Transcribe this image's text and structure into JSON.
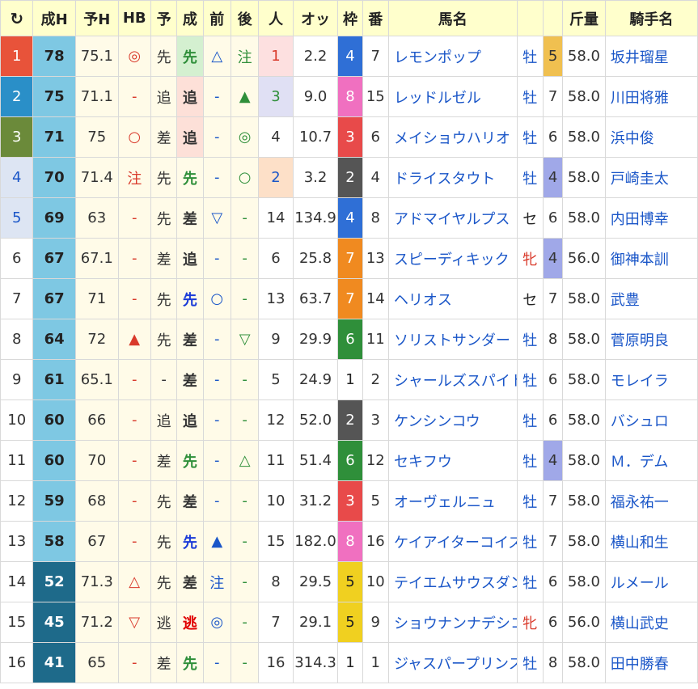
{
  "headers": [
    "↻",
    "成H",
    "予H",
    "HB",
    "予",
    "成",
    "前",
    "後",
    "人",
    "オッ",
    "枠",
    "番",
    "馬名",
    "",
    "",
    "斤量",
    "騎手名"
  ],
  "colors": {
    "header_bg": "#ffffcc",
    "link": "#1a56c8",
    "rank1": "#e8533a",
    "rank2": "#2a8fc8",
    "rank3": "#6b8a3a",
    "rank_light": "#dde5f3",
    "seih_light": "#7ec8e3",
    "seih_dark": "#1e6a8a",
    "frame": {
      "1": "#ffffff",
      "2": "#555555",
      "3": "#e84a4a",
      "4": "#2f6fd6",
      "5": "#f0d020",
      "6": "#2f8f3a",
      "7": "#f08a20",
      "8": "#f070c0"
    }
  },
  "rows": [
    {
      "rank": "1",
      "rank_color": "#e8533a",
      "rank_text": "#ffffff",
      "seih": "78",
      "seih_bg": "#7ec8e3",
      "seih_text": "#222",
      "yoh": "75.1",
      "hb": "◎",
      "hb_color": "#d93a2b",
      "yo": "先",
      "sei": "先",
      "sei_bg": "#d4f0d0",
      "sei_color": "#2f8f3a",
      "mae": "△",
      "mae_color": "#1a56c8",
      "ato": "注",
      "ato_color": "#2f8f3a",
      "ninki": "1",
      "ninki_bg": "#fde0e0",
      "ninki_color": "#d93a2b",
      "odds": "2.2",
      "waku": "4",
      "ban": "7",
      "name": "レモンポップ",
      "sex": "牡",
      "sex_class": "sexm",
      "w_mark": "5",
      "w_bg": "#f0c050",
      "kinryo": "58.0",
      "rider": "坂井瑠星"
    },
    {
      "rank": "2",
      "rank_color": "#2a8fc8",
      "rank_text": "#ffffff",
      "seih": "75",
      "seih_bg": "#7ec8e3",
      "seih_text": "#222",
      "yoh": "71.1",
      "hb": "-",
      "hb_color": "#d93a2b",
      "yo": "追",
      "sei": "追",
      "sei_bg": "#fde0d8",
      "sei_color": "#333",
      "mae": "-",
      "mae_color": "#1a56c8",
      "ato": "▲",
      "ato_color": "#2f8f3a",
      "ninki": "3",
      "ninki_bg": "#e0e0f4",
      "ninki_color": "#2f8f3a",
      "odds": "9.0",
      "waku": "8",
      "ban": "15",
      "name": "レッドルゼル",
      "sex": "牡",
      "sex_class": "sexm",
      "w_mark": "7",
      "w_bg": "#ffffff",
      "kinryo": "58.0",
      "rider": "川田将雅"
    },
    {
      "rank": "3",
      "rank_color": "#6b8a3a",
      "rank_text": "#ffffff",
      "seih": "71",
      "seih_bg": "#7ec8e3",
      "seih_text": "#222",
      "yoh": "75",
      "hb": "○",
      "hb_color": "#d93a2b",
      "yo": "差",
      "sei": "追",
      "sei_bg": "#fde0d8",
      "sei_color": "#333",
      "mae": "-",
      "mae_color": "#1a56c8",
      "ato": "◎",
      "ato_color": "#2f8f3a",
      "ninki": "4",
      "ninki_bg": "#ffffff",
      "ninki_color": "#333",
      "odds": "10.7",
      "waku": "3",
      "ban": "6",
      "name": "メイショウハリオ",
      "sex": "牡",
      "sex_class": "sexm",
      "w_mark": "6",
      "w_bg": "#ffffff",
      "kinryo": "58.0",
      "rider": "浜中俊"
    },
    {
      "rank": "4",
      "rank_color": "#dde5f3",
      "rank_text": "#1a56c8",
      "seih": "70",
      "seih_bg": "#7ec8e3",
      "seih_text": "#222",
      "yoh": "71.4",
      "hb": "注",
      "hb_color": "#d93a2b",
      "yo": "先",
      "sei": "先",
      "sei_bg": "#fffbe8",
      "sei_color": "#2f8f3a",
      "mae": "-",
      "mae_color": "#1a56c8",
      "ato": "○",
      "ato_color": "#2f8f3a",
      "ninki": "2",
      "ninki_bg": "#fde0c8",
      "ninki_color": "#1a56c8",
      "odds": "3.2",
      "waku": "2",
      "ban": "4",
      "name": "ドライスタウト",
      "sex": "牡",
      "sex_class": "sexm",
      "w_mark": "4",
      "w_bg": "#a0a8e8",
      "kinryo": "58.0",
      "rider": "戸崎圭太"
    },
    {
      "rank": "5",
      "rank_color": "#dde5f3",
      "rank_text": "#1a56c8",
      "seih": "69",
      "seih_bg": "#7ec8e3",
      "seih_text": "#222",
      "yoh": "63",
      "hb": "-",
      "hb_color": "#d93a2b",
      "yo": "先",
      "sei": "差",
      "sei_bg": "#fffbe8",
      "sei_color": "#333",
      "mae": "▽",
      "mae_color": "#1a56c8",
      "ato": "-",
      "ato_color": "#2f8f3a",
      "ninki": "14",
      "ninki_bg": "#ffffff",
      "ninki_color": "#333",
      "odds": "134.9",
      "waku": "4",
      "ban": "8",
      "name": "アドマイヤルプス",
      "sex": "セ",
      "sex_class": "sexg",
      "w_mark": "6",
      "w_bg": "#ffffff",
      "kinryo": "58.0",
      "rider": "内田博幸"
    },
    {
      "rank": "6",
      "rank_color": "#ffffff",
      "rank_text": "#333",
      "seih": "67",
      "seih_bg": "#7ec8e3",
      "seih_text": "#222",
      "yoh": "67.1",
      "hb": "-",
      "hb_color": "#d93a2b",
      "yo": "差",
      "sei": "追",
      "sei_bg": "#fffbe8",
      "sei_color": "#333",
      "mae": "-",
      "mae_color": "#1a56c8",
      "ato": "-",
      "ato_color": "#2f8f3a",
      "ninki": "6",
      "ninki_bg": "#ffffff",
      "ninki_color": "#333",
      "odds": "25.8",
      "waku": "7",
      "ban": "13",
      "name": "スピーディキック",
      "sex": "牝",
      "sex_class": "sexf",
      "w_mark": "4",
      "w_bg": "#a0a8e8",
      "kinryo": "56.0",
      "rider": "御神本訓"
    },
    {
      "rank": "7",
      "rank_color": "#ffffff",
      "rank_text": "#333",
      "seih": "67",
      "seih_bg": "#7ec8e3",
      "seih_text": "#222",
      "yoh": "71",
      "hb": "-",
      "hb_color": "#d93a2b",
      "yo": "先",
      "sei": "先",
      "sei_bg": "#fffbe8",
      "sei_color": "#1a3ad8",
      "mae": "○",
      "mae_color": "#1a56c8",
      "ato": "-",
      "ato_color": "#2f8f3a",
      "ninki": "13",
      "ninki_bg": "#ffffff",
      "ninki_color": "#333",
      "odds": "63.7",
      "waku": "7",
      "ban": "14",
      "name": "ヘリオス",
      "sex": "セ",
      "sex_class": "sexg",
      "w_mark": "7",
      "w_bg": "#ffffff",
      "kinryo": "58.0",
      "rider": "武豊"
    },
    {
      "rank": "8",
      "rank_color": "#ffffff",
      "rank_text": "#333",
      "seih": "64",
      "seih_bg": "#7ec8e3",
      "seih_text": "#222",
      "yoh": "72",
      "hb": "▲",
      "hb_color": "#d93a2b",
      "yo": "先",
      "sei": "差",
      "sei_bg": "#fffbe8",
      "sei_color": "#333",
      "mae": "-",
      "mae_color": "#1a56c8",
      "ato": "▽",
      "ato_color": "#2f8f3a",
      "ninki": "9",
      "ninki_bg": "#ffffff",
      "ninki_color": "#333",
      "odds": "29.9",
      "waku": "6",
      "ban": "11",
      "name": "ソリストサンダー",
      "sex": "牡",
      "sex_class": "sexm",
      "w_mark": "8",
      "w_bg": "#ffffff",
      "kinryo": "58.0",
      "rider": "菅原明良"
    },
    {
      "rank": "9",
      "rank_color": "#ffffff",
      "rank_text": "#333",
      "seih": "61",
      "seih_bg": "#7ec8e3",
      "seih_text": "#222",
      "yoh": "65.1",
      "hb": "-",
      "hb_color": "#d93a2b",
      "yo": "-",
      "sei": "差",
      "sei_bg": "#fffbe8",
      "sei_color": "#333",
      "mae": "-",
      "mae_color": "#1a56c8",
      "ato": "-",
      "ato_color": "#2f8f3a",
      "ninki": "5",
      "ninki_bg": "#ffffff",
      "ninki_color": "#333",
      "odds": "24.9",
      "waku": "1",
      "ban": "2",
      "name": "シャールズスパイト",
      "sex": "牡",
      "sex_class": "sexm",
      "w_mark": "6",
      "w_bg": "#ffffff",
      "kinryo": "58.0",
      "rider": "モレイラ"
    },
    {
      "rank": "10",
      "rank_color": "#ffffff",
      "rank_text": "#333",
      "seih": "60",
      "seih_bg": "#7ec8e3",
      "seih_text": "#222",
      "yoh": "66",
      "hb": "-",
      "hb_color": "#d93a2b",
      "yo": "追",
      "sei": "追",
      "sei_bg": "#fffbe8",
      "sei_color": "#333",
      "mae": "-",
      "mae_color": "#1a56c8",
      "ato": "-",
      "ato_color": "#2f8f3a",
      "ninki": "12",
      "ninki_bg": "#ffffff",
      "ninki_color": "#333",
      "odds": "52.0",
      "waku": "2",
      "ban": "3",
      "name": "ケンシンコウ",
      "sex": "牡",
      "sex_class": "sexm",
      "w_mark": "6",
      "w_bg": "#ffffff",
      "kinryo": "58.0",
      "rider": "バシュロ"
    },
    {
      "rank": "11",
      "rank_color": "#ffffff",
      "rank_text": "#333",
      "seih": "60",
      "seih_bg": "#7ec8e3",
      "seih_text": "#222",
      "yoh": "70",
      "hb": "-",
      "hb_color": "#d93a2b",
      "yo": "差",
      "sei": "先",
      "sei_bg": "#fffbe8",
      "sei_color": "#2f8f3a",
      "mae": "-",
      "mae_color": "#1a56c8",
      "ato": "△",
      "ato_color": "#2f8f3a",
      "ninki": "11",
      "ninki_bg": "#ffffff",
      "ninki_color": "#333",
      "odds": "51.4",
      "waku": "6",
      "ban": "12",
      "name": "セキフウ",
      "sex": "牡",
      "sex_class": "sexm",
      "w_mark": "4",
      "w_bg": "#a0a8e8",
      "kinryo": "58.0",
      "rider": "Ｍ．デム"
    },
    {
      "rank": "12",
      "rank_color": "#ffffff",
      "rank_text": "#333",
      "seih": "59",
      "seih_bg": "#7ec8e3",
      "seih_text": "#222",
      "yoh": "68",
      "hb": "-",
      "hb_color": "#d93a2b",
      "yo": "先",
      "sei": "差",
      "sei_bg": "#fffbe8",
      "sei_color": "#333",
      "mae": "-",
      "mae_color": "#1a56c8",
      "ato": "-",
      "ato_color": "#2f8f3a",
      "ninki": "10",
      "ninki_bg": "#ffffff",
      "ninki_color": "#333",
      "odds": "31.2",
      "waku": "3",
      "ban": "5",
      "name": "オーヴェルニュ",
      "sex": "牡",
      "sex_class": "sexm",
      "w_mark": "7",
      "w_bg": "#ffffff",
      "kinryo": "58.0",
      "rider": "福永祐一"
    },
    {
      "rank": "13",
      "rank_color": "#ffffff",
      "rank_text": "#333",
      "seih": "58",
      "seih_bg": "#7ec8e3",
      "seih_text": "#222",
      "yoh": "67",
      "hb": "-",
      "hb_color": "#d93a2b",
      "yo": "先",
      "sei": "先",
      "sei_bg": "#fffbe8",
      "sei_color": "#1a3ad8",
      "mae": "▲",
      "mae_color": "#1a56c8",
      "ato": "-",
      "ato_color": "#2f8f3a",
      "ninki": "15",
      "ninki_bg": "#ffffff",
      "ninki_color": "#333",
      "odds": "182.0",
      "waku": "8",
      "ban": "16",
      "name": "ケイアイターコイズ",
      "sex": "牡",
      "sex_class": "sexm",
      "w_mark": "7",
      "w_bg": "#ffffff",
      "kinryo": "58.0",
      "rider": "横山和生"
    },
    {
      "rank": "14",
      "rank_color": "#ffffff",
      "rank_text": "#333",
      "seih": "52",
      "seih_bg": "#1e6a8a",
      "seih_text": "#ffffff",
      "yoh": "71.3",
      "hb": "△",
      "hb_color": "#d93a2b",
      "yo": "先",
      "sei": "差",
      "sei_bg": "#fffbe8",
      "sei_color": "#333",
      "mae": "注",
      "mae_color": "#1a56c8",
      "ato": "-",
      "ato_color": "#2f8f3a",
      "ninki": "8",
      "ninki_bg": "#ffffff",
      "ninki_color": "#333",
      "odds": "29.5",
      "waku": "5",
      "ban": "10",
      "name": "テイエムサウスダン",
      "sex": "牡",
      "sex_class": "sexm",
      "w_mark": "6",
      "w_bg": "#ffffff",
      "kinryo": "58.0",
      "rider": "ルメール"
    },
    {
      "rank": "15",
      "rank_color": "#ffffff",
      "rank_text": "#333",
      "seih": "45",
      "seih_bg": "#1e6a8a",
      "seih_text": "#ffffff",
      "yoh": "71.2",
      "hb": "▽",
      "hb_color": "#d93a2b",
      "yo": "逃",
      "sei": "逃",
      "sei_bg": "#fffbe8",
      "sei_color": "#e00000",
      "mae": "◎",
      "mae_color": "#1a56c8",
      "ato": "-",
      "ato_color": "#2f8f3a",
      "ninki": "7",
      "ninki_bg": "#ffffff",
      "ninki_color": "#333",
      "odds": "29.1",
      "waku": "5",
      "ban": "9",
      "name": "ショウナンナデシコ",
      "sex": "牝",
      "sex_class": "sexf",
      "w_mark": "6",
      "w_bg": "#ffffff",
      "kinryo": "56.0",
      "rider": "横山武史"
    },
    {
      "rank": "16",
      "rank_color": "#ffffff",
      "rank_text": "#333",
      "seih": "41",
      "seih_bg": "#1e6a8a",
      "seih_text": "#ffffff",
      "yoh": "65",
      "hb": "-",
      "hb_color": "#d93a2b",
      "yo": "差",
      "sei": "先",
      "sei_bg": "#fffbe8",
      "sei_color": "#2f8f3a",
      "mae": "-",
      "mae_color": "#1a56c8",
      "ato": "-",
      "ato_color": "#2f8f3a",
      "ninki": "16",
      "ninki_bg": "#ffffff",
      "ninki_color": "#333",
      "odds": "314.3",
      "waku": "1",
      "ban": "1",
      "name": "ジャスパープリンス",
      "sex": "牡",
      "sex_class": "sexm",
      "w_mark": "8",
      "w_bg": "#ffffff",
      "kinryo": "58.0",
      "rider": "田中勝春"
    }
  ]
}
